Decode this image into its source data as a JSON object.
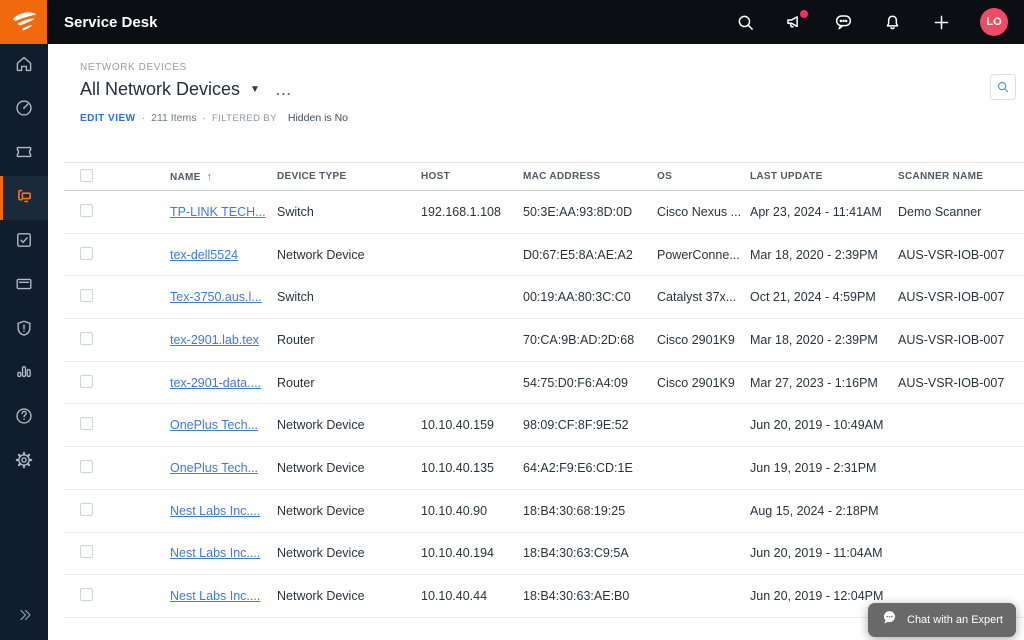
{
  "colors": {
    "accent_orange": "#F2690D",
    "link_blue": "#3C7BD9",
    "avatar_pink": "#F04A66",
    "notification_dot": "#F5315F",
    "topbar_bg": "#0B0E13",
    "sidebar_bg": "#0F1D2D",
    "active_item_bg": "#1B2A3A",
    "chat_widget_bg": "#696969"
  },
  "topbar": {
    "app_title": "Service Desk",
    "icons": [
      "search-icon",
      "megaphone-icon",
      "chat-icon",
      "bell-icon",
      "plus-icon"
    ],
    "avatar_initials": "LO"
  },
  "sidebar": {
    "items": [
      {
        "icon": "home-icon",
        "active": false
      },
      {
        "icon": "dashboard-icon",
        "active": false
      },
      {
        "icon": "ticket-icon",
        "active": false
      },
      {
        "icon": "devices-icon",
        "active": true
      },
      {
        "icon": "tasks-icon",
        "active": false
      },
      {
        "icon": "card-icon",
        "active": false
      },
      {
        "icon": "shield-icon",
        "active": false
      },
      {
        "icon": "reports-icon",
        "active": false
      },
      {
        "icon": "help-icon",
        "active": false
      },
      {
        "icon": "settings-icon",
        "active": false
      }
    ]
  },
  "page": {
    "breadcrumb": "NETWORK DEVICES",
    "title": "All Network Devices",
    "title_caret": "▼",
    "title_more": "...",
    "edit_view_label": "EDIT VIEW",
    "sep": "·",
    "items_count": "211 Items",
    "filtered_by_label": "FILTERED BY",
    "filter_value": "Hidden is No"
  },
  "table": {
    "columns": [
      {
        "label": "NAME",
        "key": "name",
        "sorted": "asc"
      },
      {
        "label": "DEVICE TYPE",
        "key": "device_type"
      },
      {
        "label": "HOST",
        "key": "host"
      },
      {
        "label": "MAC ADDRESS",
        "key": "mac_address"
      },
      {
        "label": "OS",
        "key": "os"
      },
      {
        "label": "LAST UPDATE",
        "key": "last_update"
      },
      {
        "label": "SCANNER NAME",
        "key": "scanner_name"
      }
    ],
    "rows": [
      {
        "name": "TP-LINK TECH...",
        "device_type": "Switch",
        "host": "192.168.1.108",
        "mac_address": "50:3E:AA:93:8D:0D",
        "os": "Cisco Nexus ...",
        "last_update": "Apr 23, 2024 - 11:41AM",
        "scanner_name": "Demo Scanner"
      },
      {
        "name": "tex-dell5524",
        "device_type": "Network Device",
        "host": "",
        "mac_address": "D0:67:E5:8A:AE:A2",
        "os": "PowerConne...",
        "last_update": "Mar 18, 2020 - 2:39PM",
        "scanner_name": "AUS-VSR-IOB-007"
      },
      {
        "name": "Tex-3750.aus.l...",
        "device_type": "Switch",
        "host": "",
        "mac_address": "00:19:AA:80:3C:C0",
        "os": "Catalyst 37x...",
        "last_update": "Oct 21, 2024 - 4:59PM",
        "scanner_name": "AUS-VSR-IOB-007"
      },
      {
        "name": "tex-2901.lab.tex",
        "device_type": "Router",
        "host": "",
        "mac_address": "70:CA:9B:AD:2D:68",
        "os": "Cisco 2901K9",
        "last_update": "Mar 18, 2020 - 2:39PM",
        "scanner_name": "AUS-VSR-IOB-007"
      },
      {
        "name": "tex-2901-data....",
        "device_type": "Router",
        "host": "",
        "mac_address": "54:75:D0:F6:A4:09",
        "os": "Cisco 2901K9",
        "last_update": "Mar 27, 2023 - 1:16PM",
        "scanner_name": "AUS-VSR-IOB-007"
      },
      {
        "name": "OnePlus Tech...",
        "device_type": "Network Device",
        "host": "10.10.40.159",
        "mac_address": "98:09:CF:8F:9E:52",
        "os": "",
        "last_update": "Jun 20, 2019 - 10:49AM",
        "scanner_name": ""
      },
      {
        "name": "OnePlus Tech...",
        "device_type": "Network Device",
        "host": "10.10.40.135",
        "mac_address": "64:A2:F9:E6:CD:1E",
        "os": "",
        "last_update": "Jun 19, 2019 - 2:31PM",
        "scanner_name": ""
      },
      {
        "name": "Nest Labs Inc....",
        "device_type": "Network Device",
        "host": "10.10.40.90",
        "mac_address": "18:B4:30:68:19:25",
        "os": "",
        "last_update": "Aug 15, 2024 - 2:18PM",
        "scanner_name": ""
      },
      {
        "name": "Nest Labs Inc....",
        "device_type": "Network Device",
        "host": "10.10.40.194",
        "mac_address": "18:B4:30:63:C9:5A",
        "os": "",
        "last_update": "Jun 20, 2019 - 11:04AM",
        "scanner_name": ""
      },
      {
        "name": "Nest Labs Inc....",
        "device_type": "Network Device",
        "host": "10.10.40.44",
        "mac_address": "18:B4:30:63:AE:B0",
        "os": "",
        "last_update": "Jun 20, 2019 - 12:04PM",
        "scanner_name": ""
      }
    ]
  },
  "chat_widget": {
    "label": "Chat with an Expert"
  }
}
